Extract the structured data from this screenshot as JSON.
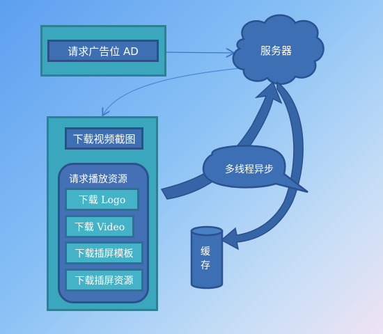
{
  "top_box": {
    "label": "请求广告位 AD"
  },
  "server": {
    "label": "服务器"
  },
  "main_panel": {
    "download_screenshot_label": "下载视频截图",
    "group_title": "请求播放资源",
    "items": [
      {
        "label": "下载 Logo"
      },
      {
        "label": "下载 Video"
      },
      {
        "label": "下载插屏模板"
      },
      {
        "label": "下载插屏资源"
      }
    ]
  },
  "async_bubble": {
    "label": "多线程异步"
  },
  "cache": {
    "label": "缓存"
  },
  "colors": {
    "panel_teal": "#3aa7bf",
    "box_blue": "#3f6fb3",
    "arrow_blue": "#3565a6",
    "cloud_blue": "#3d6fb5"
  }
}
